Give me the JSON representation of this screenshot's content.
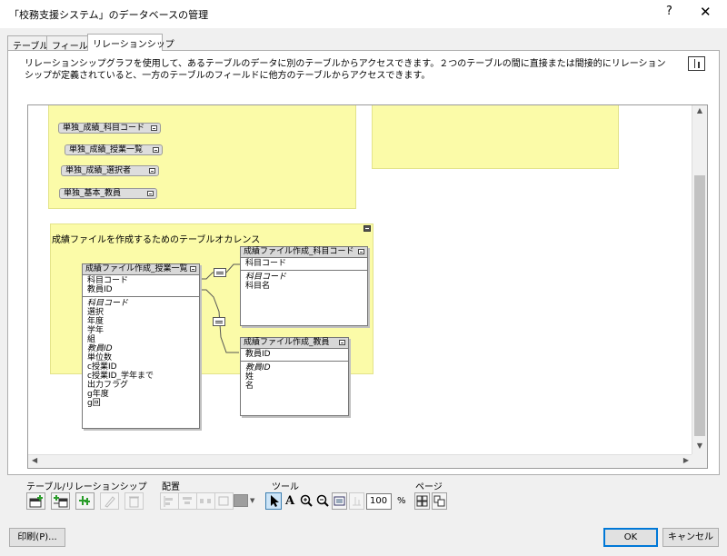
{
  "window": {
    "title": "「校務支援システム」のデータベースの管理",
    "help_glyph": "?",
    "close_glyph": "✕"
  },
  "tabs": [
    {
      "label": "テーブル",
      "active": false
    },
    {
      "label": "フィールド",
      "active": false
    },
    {
      "label": "リレーションシップ",
      "active": true
    }
  ],
  "description": "リレーションシップグラフを使用して、あるテーブルのデータに別のテーブルからアクセスできます。２つのテーブルの間に直接または間接的にリレーションシップが定義されていると、一方のテーブルのフィールドに他方のテーブルからアクセスできます。",
  "graph": {
    "collapsed_tables": [
      "単独_成績_科目コード",
      "単独_成績_授業一覧",
      "単独_成績_選択者",
      "単独_基本_教員"
    ],
    "group_label": "成績ファイルを作成するためのテーブルオカレンス",
    "tables": {
      "jugyo": {
        "name": "成績ファイル作成_授業一覧",
        "keys": [
          "科目コード",
          "教員ID"
        ],
        "fields": [
          {
            "label": "科目コード",
            "italic": true
          },
          {
            "label": "選択",
            "italic": false
          },
          {
            "label": "年度",
            "italic": false
          },
          {
            "label": "学年",
            "italic": false
          },
          {
            "label": "組",
            "italic": false
          },
          {
            "label": "教員ID",
            "italic": true
          },
          {
            "label": "単位数",
            "italic": false
          },
          {
            "label": "c授業ID",
            "italic": false
          },
          {
            "label": "c授業ID_学年まで",
            "italic": false
          },
          {
            "label": "出力フラグ",
            "italic": false
          },
          {
            "label": "g年度",
            "italic": false
          },
          {
            "label": "g回",
            "italic": false
          }
        ]
      },
      "kamoku": {
        "name": "成績ファイル作成_科目コード",
        "keys": [
          "科目コード"
        ],
        "fields": [
          {
            "label": "科目コード",
            "italic": true
          },
          {
            "label": "科目名",
            "italic": false
          }
        ]
      },
      "kyoin": {
        "name": "成績ファイル作成_教員",
        "keys": [
          "教員ID"
        ],
        "fields": [
          {
            "label": "教員ID",
            "italic": true
          },
          {
            "label": "姓",
            "italic": false
          },
          {
            "label": "名",
            "italic": false
          }
        ]
      }
    }
  },
  "toolbar": {
    "section_table_label": "テーブル/リレーションシップ",
    "section_arrange_label": "配置",
    "section_tools_label": "ツール",
    "section_page_label": "ページ",
    "zoom_value": "100",
    "zoom_unit": "%",
    "text_tool_glyph": "A",
    "icons": [
      "add-table-icon",
      "add-relationship-icon",
      "duplicate-icon",
      "edit-pencil-icon",
      "delete-trash-icon",
      "align-left-icon",
      "align-center-icon",
      "distribute-icon",
      "resize-icon",
      "color-swatch-icon",
      "pointer-icon",
      "text-tool-icon",
      "zoom-in-icon",
      "zoom-out-icon",
      "fit-window-icon",
      "page-breaks-icon",
      "page-setup-icon",
      "print-preview-icon"
    ],
    "swatch_color": "#9e9e9e"
  },
  "buttons": {
    "print": "印刷(P)...",
    "ok": "OK",
    "cancel": "キャンセル"
  },
  "colors": {
    "group_fill": "#fbfba8",
    "table_header": "#d8d8d8"
  }
}
